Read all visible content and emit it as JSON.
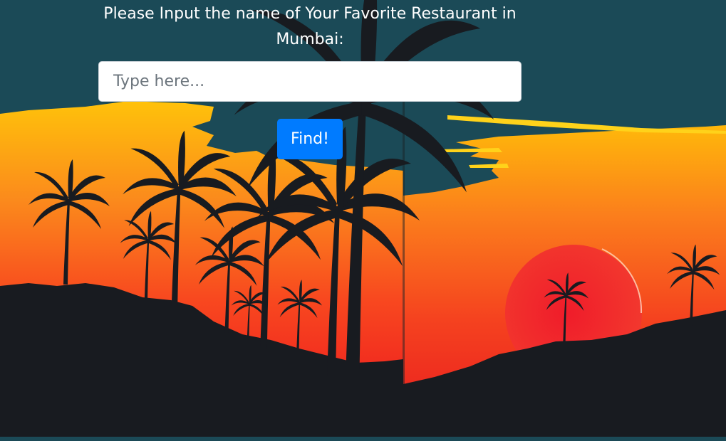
{
  "form": {
    "prompt_line1": "Please Input the name of Your Favorite Restaurant in",
    "prompt_line2": "Mumbai:",
    "input_placeholder": "Type here...",
    "input_value": "",
    "button_label": "Find!"
  },
  "colors": {
    "teal_sky": "#1b4a57",
    "sunset_yellow": "#ffc107",
    "sunset_orange": "#fb6a1e",
    "sunset_red": "#f0261f",
    "silhouette": "#181b20",
    "button_blue": "#007bff"
  },
  "background": {
    "icons": [
      "palm-tree-icon",
      "sun-icon"
    ]
  }
}
